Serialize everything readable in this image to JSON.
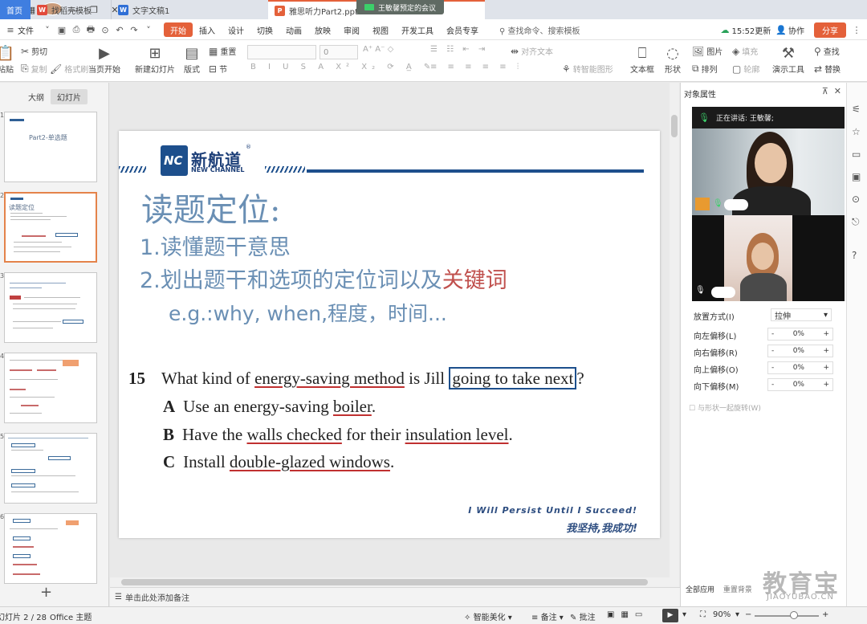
{
  "tabs": [
    {
      "label": "首页"
    },
    {
      "label": "找稻壳模板"
    },
    {
      "label": "文字文稿1"
    },
    {
      "label": "雅思听力Part2.pptx"
    }
  ],
  "meeting_label": "王敏馨预定的会议",
  "menu": {
    "file": "文件",
    "items": [
      "开始",
      "插入",
      "设计",
      "切换",
      "动画",
      "放映",
      "审阅",
      "视图",
      "开发工具",
      "会员专享"
    ],
    "search": "查找命令、搜索模板",
    "sync": "15:52更新",
    "collab": "协作",
    "share": "分享"
  },
  "ribbon": {
    "paste": "粘贴",
    "cut": "剪切",
    "copy": "复制",
    "format_painter": "格式刷",
    "from_current": "当页开始",
    "new_slide": "新建幻灯片",
    "layout": "版式",
    "section": "节",
    "reset": "重置",
    "font_size": "0",
    "align_text": "对齐文本",
    "smart_art": "转智能图形",
    "textbox": "文本框",
    "shape": "形状",
    "picture": "图片",
    "fill": "填充",
    "arrange": "排列",
    "outline": "轮廓",
    "present_tools": "演示工具",
    "find": "查找",
    "replace": "替换"
  },
  "left_panel": {
    "tab_outline": "大纲",
    "tab_slides": "幻灯片",
    "thumb1_title": "Part2-单选题",
    "thumb2_title": "读题定位",
    "thumb_nums": [
      "1",
      "2",
      "3",
      "4",
      "5",
      "6"
    ]
  },
  "slide": {
    "logo_zh": "新航道",
    "logo_en": "NEW CHANNEL",
    "title": "读题定位:",
    "line1": "1.读懂题干意思",
    "line2_prefix": "2.划出题干和选项的定位词以及",
    "line2_keyword": "关键词",
    "line3": "e.g.:why, when,程度，时间...",
    "question": {
      "number": "15",
      "q_pre": "What kind of ",
      "q_ul": "energy-saving method",
      "q_mid": " is Jill ",
      "q_box": "going to take next",
      "q_end": "?",
      "a_letter": "A",
      "a_pre": "Use an energy-saving ",
      "a_ul": "boiler",
      "a_end": ".",
      "b_letter": "B",
      "b_pre": "Have the ",
      "b_ul1": "walls checked",
      "b_mid": " for their ",
      "b_ul2": "insulation level",
      "b_end": ".",
      "c_letter": "C",
      "c_pre": "Install ",
      "c_ul": "double-glazed windows",
      "c_end": "."
    },
    "motto_en": "I Will Persist Until I Succeed!",
    "motto_zh": "我坚持,我成功!"
  },
  "notes_placeholder": "单击此处添加备注",
  "right_panel": {
    "title": "对象属性",
    "placement_label": "放置方式(I)",
    "placement_value": "拉伸",
    "offsets": [
      {
        "label": "向左偏移(L)",
        "value": "0%"
      },
      {
        "label": "向右偏移(R)",
        "value": "0%"
      },
      {
        "label": "向上偏移(O)",
        "value": "0%"
      },
      {
        "label": "向下偏移(M)",
        "value": "0%"
      }
    ],
    "rotate_with_shape": "与形状一起旋转(W)",
    "apply_all": "全部应用",
    "reset_bg": "重置背景"
  },
  "video": {
    "speaking": "正在讲话: 王敏馨;"
  },
  "status": {
    "slide_pos": "幻灯片 2 / 28",
    "theme": "Office 主题",
    "beautify": "智能美化",
    "notes": "备注",
    "comments": "批注",
    "zoom": "90%"
  },
  "watermark": {
    "cn": "教育宝",
    "en": "JIAOYUBAO.CN"
  },
  "colors": {
    "accent": "#e4613a",
    "slide_blue": "#6a8fb4",
    "keyword_red": "#c0504d",
    "logo_navy": "#1d4f8c"
  }
}
